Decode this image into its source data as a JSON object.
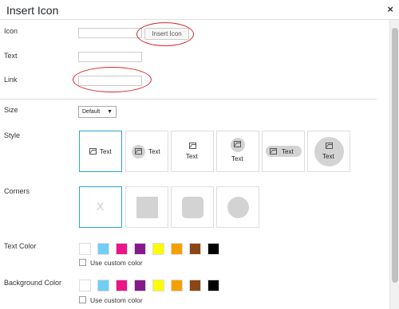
{
  "window": {
    "title": "Insert Icon",
    "close_glyph": "×"
  },
  "fields": {
    "icon_label": "Icon",
    "insert_icon_button": "Insert Icon",
    "text_label": "Text",
    "link_label": "Link"
  },
  "size": {
    "label": "Size",
    "selected": "Default",
    "caret": "▼"
  },
  "style": {
    "label": "Style",
    "options": [
      {
        "text": "Text"
      },
      {
        "text": "Text"
      },
      {
        "text": "Text"
      },
      {
        "text": "Text"
      },
      {
        "text": "Text"
      },
      {
        "text": "Text"
      }
    ]
  },
  "corners": {
    "label": "Corners",
    "none_glyph": "X"
  },
  "text_color": {
    "label": "Text Color",
    "custom_label": "Use custom color",
    "swatches": [
      "#ffffff",
      "#6fcff4",
      "#ed1389",
      "#86198c",
      "#fcfb00",
      "#f5a000",
      "#8a4613",
      "#000000"
    ]
  },
  "background_color": {
    "label": "Background Color",
    "custom_label": "Use custom color",
    "swatches": [
      "#ffffff",
      "#6fcff4",
      "#ed1389",
      "#86198c",
      "#fcfb00",
      "#f5a000",
      "#8a4613",
      "#000000"
    ]
  },
  "colors": {
    "accent": "#2ea2cc",
    "annotation": "#d9272e",
    "shape_fill": "#d3d3d3"
  }
}
